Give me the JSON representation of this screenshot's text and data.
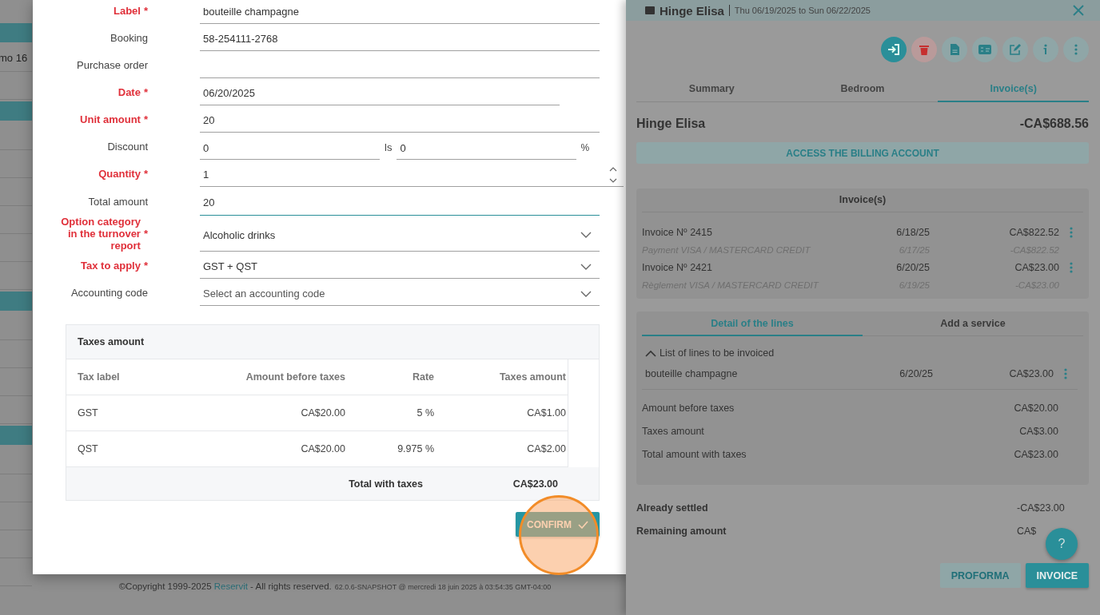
{
  "background_page": {
    "visible_text": "mo 16"
  },
  "modal": {
    "fields": [
      {
        "kind": "text",
        "label": "Label",
        "required": true,
        "mark": "*",
        "value": "bouteille champagne",
        "focused": false
      },
      {
        "kind": "text",
        "label": "Booking",
        "required": false,
        "value": "58-254111-2768",
        "focused": false
      },
      {
        "kind": "text",
        "label": "Purchase order",
        "required": false,
        "focused": false
      },
      {
        "kind": "date",
        "label": "Date",
        "required": true,
        "mark": "*",
        "value": "06/20/2025",
        "focused": false
      },
      {
        "kind": "text",
        "label": "Unit amount",
        "required": true,
        "mark": "*",
        "value": "20",
        "focused": false
      },
      {
        "kind": "discount",
        "label": "Discount",
        "required": false,
        "value": "0",
        "separator": "ls",
        "value_2": "0",
        "unit": "%",
        "focused": false
      },
      {
        "kind": "number",
        "label": "Quantity",
        "required": true,
        "mark": "*",
        "value": "1",
        "focused": false
      },
      {
        "kind": "text",
        "label": "Total amount",
        "required": false,
        "value": "20",
        "focused": true
      },
      {
        "kind": "select",
        "label": "Option category in the turnover report",
        "required": true,
        "mark": "*",
        "value": "Alcoholic drinks",
        "focused": false
      },
      {
        "kind": "select",
        "label": "Tax to apply",
        "required": true,
        "mark": "*",
        "value": "GST + QST",
        "focused": false
      },
      {
        "kind": "select",
        "label": "Accounting code",
        "required": false,
        "placeholder": "Select an accounting code",
        "focused": false
      }
    ],
    "taxes": {
      "title": "Taxes amount",
      "columns": [
        "Tax label",
        "Amount before taxes",
        "Rate",
        "Taxes amount"
      ],
      "rows": [
        [
          "GST",
          "CA$20.00",
          "5 %",
          "CA$1.00"
        ],
        [
          "QST",
          "CA$20.00",
          "9.975 %",
          "CA$2.00"
        ]
      ],
      "total_label": "Total with taxes",
      "total": "CA$23.00"
    },
    "confirm_button": "CONFIRM"
  },
  "footer": {
    "copyright": "©Copyright 1999-2025",
    "link": "Reservit",
    "rights": "- All rights reserved.",
    "version": "62.0.6-SNAPSHOT @ mercredi 18 juin 2025 à 03:54:35 GMT-04:00"
  },
  "panel": {
    "header": {
      "title": "Hinge Elisa",
      "dates": "Thu 06/19/2025 to Sun 06/22/2025"
    },
    "tabs": [
      {
        "label": "Summary",
        "selected": false
      },
      {
        "label": "Bedroom",
        "selected": false
      },
      {
        "label": "Invoice(s)",
        "selected": true
      }
    ],
    "guest_name": "Hinge Elisa",
    "balance": "-CA$688.56",
    "billing_button": "ACCESS THE BILLING ACCOUNT",
    "invoices": {
      "title": "Invoice(s)",
      "items": [
        {
          "kind": "invoice",
          "label": "Invoice Nº 2415",
          "date": "6/18/25",
          "amount": "CA$822.52"
        },
        {
          "kind": "payment",
          "label": "Payment VISA / MASTERCARD CREDIT",
          "date": "6/17/25",
          "amount": "-CA$822.52"
        },
        {
          "kind": "invoice",
          "label": "Invoice Nº 2421",
          "date": "6/20/25",
          "amount": "CA$23.00"
        },
        {
          "kind": "payment",
          "label": "Règlement VISA / MASTERCARD CREDIT",
          "date": "6/19/25",
          "amount": "-CA$23.00"
        }
      ]
    },
    "detail": {
      "tabs": [
        {
          "label": "Detail of the lines",
          "selected": true
        },
        {
          "label": "Add a service",
          "selected": false
        }
      ],
      "section_label": "List of lines to be invoiced",
      "expanded": true,
      "lines": [
        {
          "label": "bouteille champagne",
          "date": "6/20/25",
          "amount": "CA$23.00"
        }
      ],
      "totals": [
        {
          "label": "Amount before taxes",
          "value": "CA$20.00"
        },
        {
          "label": "Taxes amount",
          "value": "CA$3.00"
        },
        {
          "label": "Total amount with taxes",
          "value": "CA$23.00"
        }
      ]
    },
    "summary": [
      {
        "label": "Already settled",
        "value": "-CA$23.00"
      },
      {
        "label": "Remaining amount",
        "value": "CA$"
      }
    ],
    "buttons": [
      {
        "label": "PROFORMA",
        "kind": "secondary"
      },
      {
        "label": "INVOICE",
        "kind": "primary"
      }
    ],
    "help": "?"
  }
}
